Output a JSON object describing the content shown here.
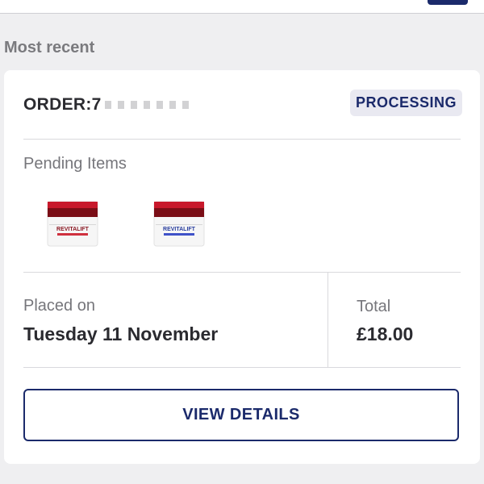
{
  "section": {
    "title": "Most recent"
  },
  "order": {
    "label": "ORDER:",
    "number_visible": "7"
  },
  "status": {
    "label": "PROCESSING",
    "text_color": "#1b2a6b",
    "background_color": "#e9e9f1"
  },
  "pending": {
    "label": "Pending Items",
    "items": [
      {
        "icon": "cream-jar-day-icon",
        "brand_text": "REVITALIFT"
      },
      {
        "icon": "cream-jar-night-icon",
        "brand_text": "REVITALIFT"
      }
    ]
  },
  "placed": {
    "label": "Placed on",
    "date": "Tuesday 11 November"
  },
  "total": {
    "label": "Total",
    "value": "£18.00"
  },
  "actions": {
    "view_details_label": "VIEW DETAILS"
  },
  "colors": {
    "brand_navy": "#1b2a6b",
    "page_background": "#efeff1",
    "card_background": "#ffffff",
    "muted_text": "#76767b"
  }
}
